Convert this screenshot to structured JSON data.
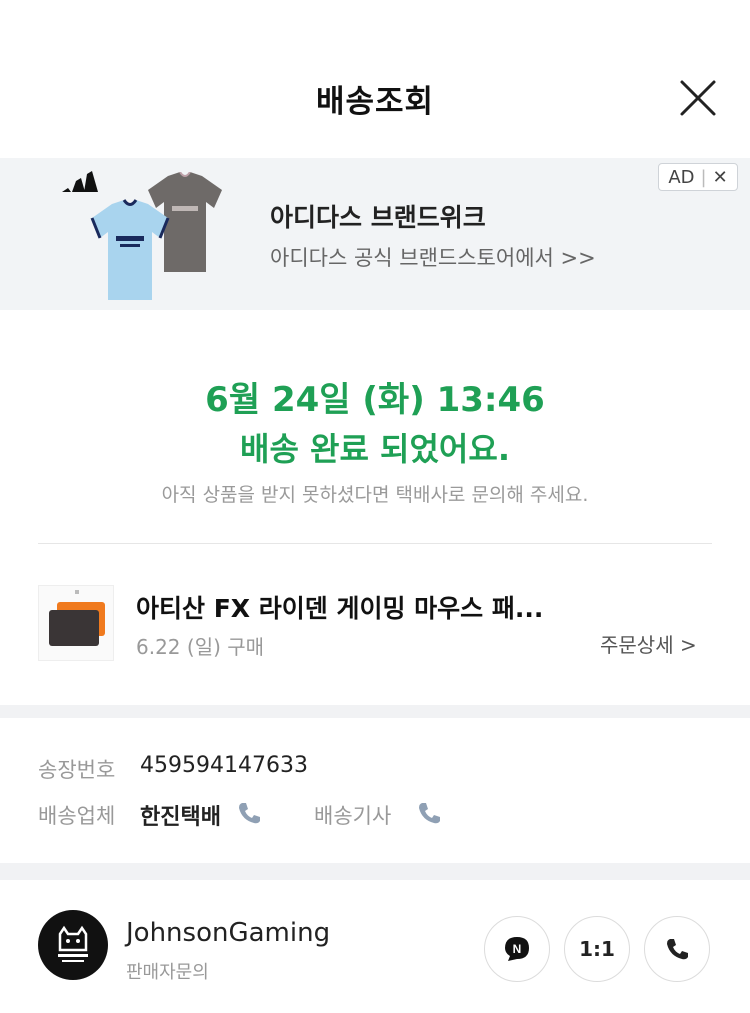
{
  "header": {
    "title": "배송조회"
  },
  "ad": {
    "badge_ad": "AD",
    "badge_close": "✕",
    "title": "아디다스 브랜드위크",
    "subtitle": "아디다스 공식 브랜드스토어에서 >>"
  },
  "status": {
    "date": "6월 24일 (화) 13:46",
    "message": "배송 완료 되었어요.",
    "note": "아직 상품을 받지 못하셨다면 택배사로 문의해 주세요."
  },
  "product": {
    "name": "아티산 FX 라이덴 게이밍 마우스 패...",
    "purchase_date": "6.22 (일) 구매",
    "detail_link": "주문상세 >"
  },
  "tracking": {
    "invoice_label": "송장번호",
    "invoice_number": "459594147633",
    "carrier_label": "배송업체",
    "carrier_name": "한진택배",
    "driver_label": "배송기사"
  },
  "seller": {
    "name": "JohnsonGaming",
    "inquiry_label": "판매자문의",
    "talk_button": "N",
    "chat_button": "1:1"
  },
  "colors": {
    "accent_green": "#1fa055",
    "band_gray": "#f1f2f4"
  }
}
